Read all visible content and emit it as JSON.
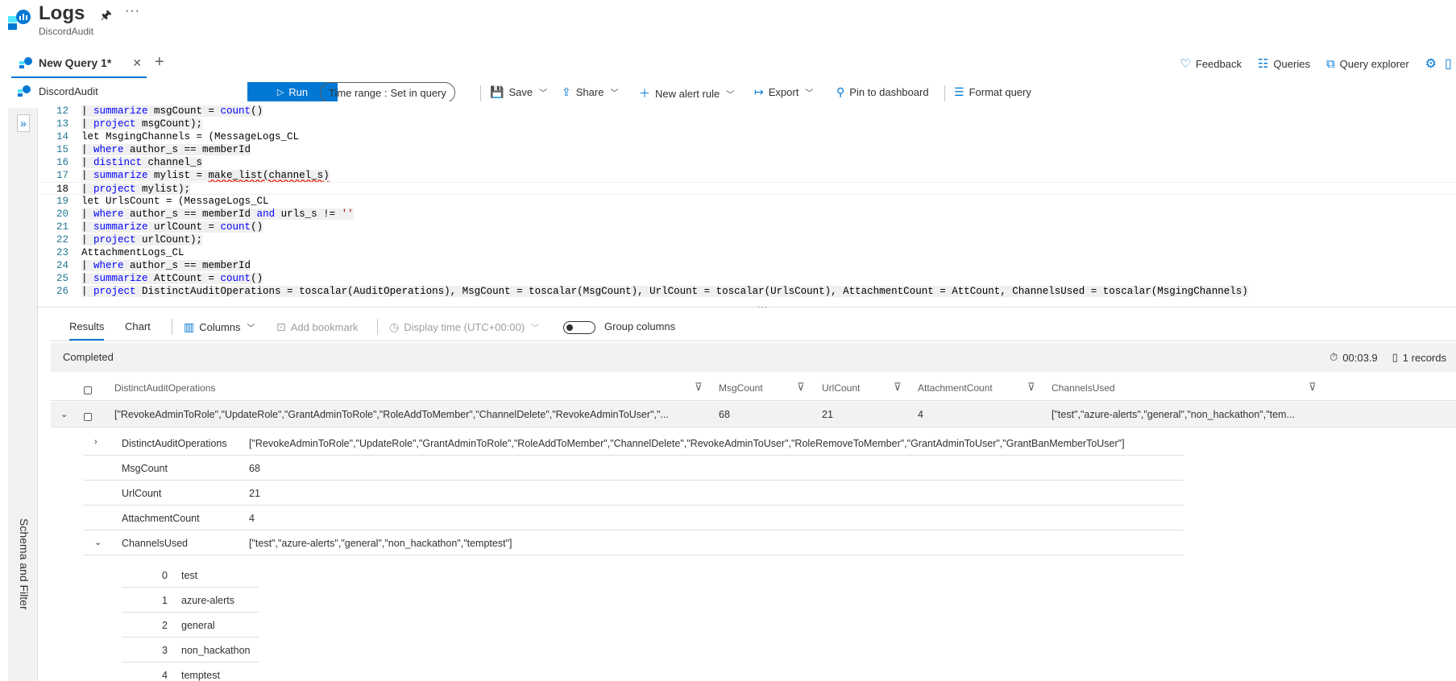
{
  "header": {
    "title": "Logs",
    "subtitle": "DiscordAudit"
  },
  "tabs": [
    {
      "label": "New Query 1*",
      "active": true
    }
  ],
  "top_actions": {
    "feedback": "Feedback",
    "queries": "Queries",
    "query_explorer": "Query explorer"
  },
  "toolbar": {
    "scope": "DiscordAudit",
    "run": "Run",
    "time_range_label": "Time range :",
    "time_range_value": "Set in query",
    "save": "Save",
    "share": "Share",
    "new_alert_rule": "New alert rule",
    "export": "Export",
    "pin_to_dashboard": "Pin to dashboard",
    "format_query": "Format query"
  },
  "side_panel": {
    "label": "Schema and Filter"
  },
  "editor": {
    "current_line": 18,
    "lines": [
      {
        "n": "12",
        "text": "| summarize msgCount = count()"
      },
      {
        "n": "13",
        "text": "| project msgCount);"
      },
      {
        "n": "14",
        "text": "let MsgingChannels = (MessageLogs_CL"
      },
      {
        "n": "15",
        "text": "| where author_s == memberId"
      },
      {
        "n": "16",
        "text": "| distinct channel_s"
      },
      {
        "n": "17",
        "text": "| summarize mylist = make_list(channel_s)"
      },
      {
        "n": "18",
        "text": "| project mylist);"
      },
      {
        "n": "19",
        "text": "let UrlsCount = (MessageLogs_CL"
      },
      {
        "n": "20",
        "text": "| where author_s == memberId and urls_s != ''"
      },
      {
        "n": "21",
        "text": "| summarize urlCount = count()"
      },
      {
        "n": "22",
        "text": "| project urlCount);"
      },
      {
        "n": "23",
        "text": "AttachmentLogs_CL"
      },
      {
        "n": "24",
        "text": "| where author_s == memberId"
      },
      {
        "n": "25",
        "text": "| summarize AttCount = count()"
      },
      {
        "n": "26",
        "text": "| project DistinctAuditOperations = toscalar(AuditOperations), MsgCount = toscalar(MsgCount), UrlCount = toscalar(UrlsCount), AttachmentCount = AttCount, ChannelsUsed = toscalar(MsgingChannels)"
      }
    ]
  },
  "results": {
    "tabs": {
      "results": "Results",
      "chart": "Chart"
    },
    "columns_btn": "Columns",
    "add_bookmark": "Add bookmark",
    "display_time": "Display time (UTC+00:00)",
    "group_columns": "Group columns",
    "status": "Completed",
    "duration": "00:03.9",
    "records": "1 records",
    "headers": [
      "DistinctAuditOperations",
      "MsgCount",
      "UrlCount",
      "AttachmentCount",
      "ChannelsUsed"
    ],
    "row": {
      "DistinctAuditOperations": "[\"RevokeAdminToRole\",\"UpdateRole\",\"GrantAdminToRole\",\"RoleAddToMember\",\"ChannelDelete\",\"RevokeAdminToUser\",\"...",
      "MsgCount": "68",
      "UrlCount": "21",
      "AttachmentCount": "4",
      "ChannelsUsed": "[\"test\",\"azure-alerts\",\"general\",\"non_hackathon\",\"tem..."
    },
    "detail": [
      {
        "key": "DistinctAuditOperations",
        "value": "[\"RevokeAdminToRole\",\"UpdateRole\",\"GrantAdminToRole\",\"RoleAddToMember\",\"ChannelDelete\",\"RevokeAdminToUser\",\"RoleRemoveToMember\",\"GrantAdminToUser\",\"GrantBanMemberToUser\"]"
      },
      {
        "key": "MsgCount",
        "value": "68"
      },
      {
        "key": "UrlCount",
        "value": "21"
      },
      {
        "key": "AttachmentCount",
        "value": "4"
      },
      {
        "key": "ChannelsUsed",
        "value": "[\"test\",\"azure-alerts\",\"general\",\"non_hackathon\",\"temptest\"]"
      }
    ],
    "channels": [
      {
        "i": "0",
        "v": "test"
      },
      {
        "i": "1",
        "v": "azure-alerts"
      },
      {
        "i": "2",
        "v": "general"
      },
      {
        "i": "3",
        "v": "non_hackathon"
      },
      {
        "i": "4",
        "v": "temptest"
      }
    ]
  },
  "colors": {
    "accent": "#0078d4",
    "keyword": "#0000ff",
    "string": "#a31515",
    "line_number": "#237893"
  }
}
